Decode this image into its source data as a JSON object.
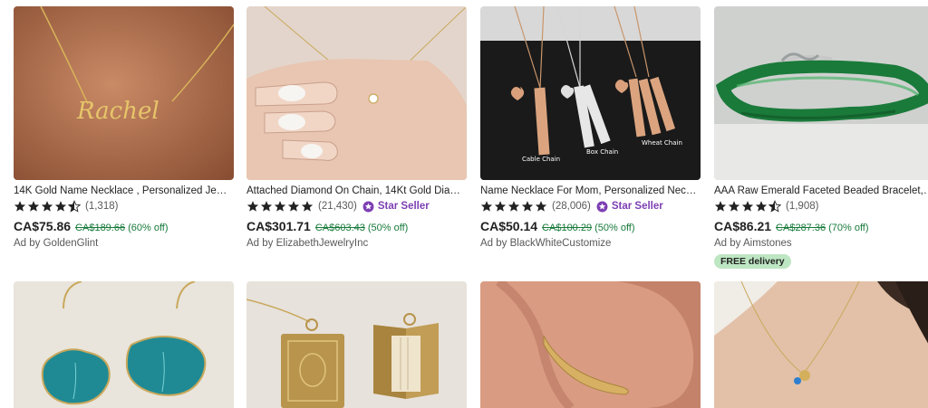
{
  "listings": [
    {
      "title": "14K Gold Name Necklace , Personalized Jew…",
      "rating": 4.5,
      "reviews": "(1,318)",
      "star_seller": "",
      "price": "CA$75.86",
      "original_price": "CA$189.66",
      "discount": "(60% off)",
      "ad": "Ad by GoldenGlint",
      "free_delivery": "",
      "image_text": "Rachel"
    },
    {
      "title": "Attached Diamond On Chain, 14Kt Gold Dia…",
      "rating": 5,
      "reviews": "(21,430)",
      "star_seller": "Star Seller",
      "price": "CA$301.71",
      "original_price": "CA$603.43",
      "discount": "(50% off)",
      "ad": "Ad by ElizabethJewelryInc",
      "free_delivery": ""
    },
    {
      "title": "Name Necklace For Mom, Personalized Neck…",
      "rating": 5,
      "reviews": "(28,006)",
      "star_seller": "Star Seller",
      "price": "CA$50.14",
      "original_price": "CA$100.29",
      "discount": "(50% off)",
      "ad": "Ad by BlackWhiteCustomize",
      "free_delivery": "",
      "image_labels": [
        "Cable Chain",
        "Box Chain",
        "Wheat Chain"
      ]
    },
    {
      "title": "AAA Raw Emerald Faceted Beaded Bracelet, …",
      "rating": 4.5,
      "reviews": "(1,908)",
      "star_seller": "",
      "price": "CA$86.21",
      "original_price": "CA$287.36",
      "discount": "(70% off)",
      "ad": "Ad by Aimstones",
      "free_delivery": "FREE delivery"
    }
  ],
  "colors": {
    "star": "#222222",
    "star_seller": "#7d3fb3",
    "sale": "#177a3a",
    "free_delivery_bg": "#bde6c2"
  }
}
